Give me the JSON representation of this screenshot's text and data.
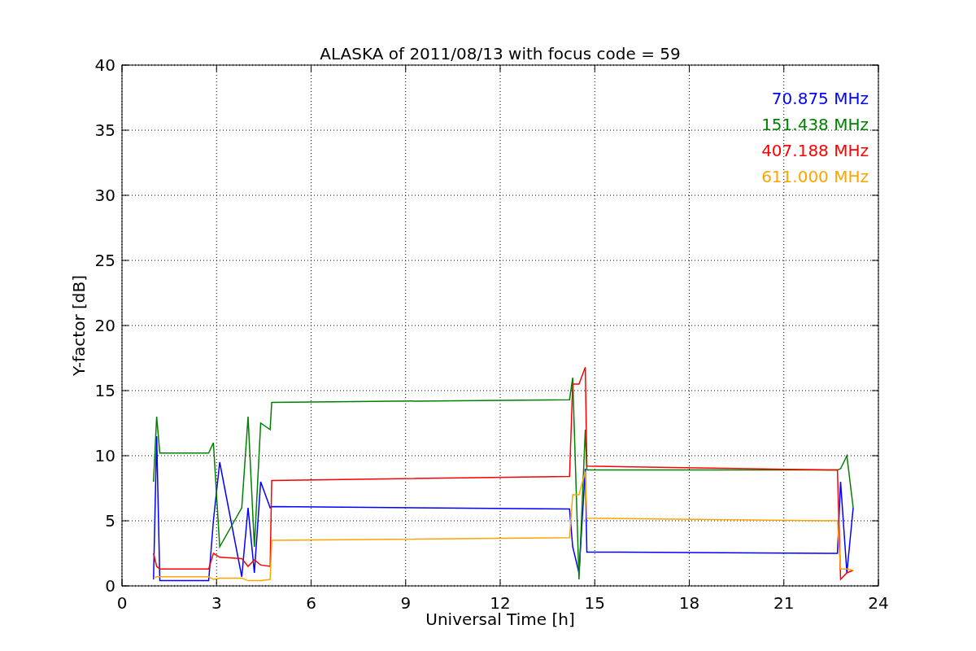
{
  "figure": {
    "chart_data": {
      "type": "line",
      "title": "ALASKA of 2011/08/13 with focus code = 59",
      "xlabel": "Universal Time [h]",
      "ylabel": "Y-factor [dB]",
      "x": [
        1.0,
        1.1,
        1.2,
        2.75,
        2.9,
        3.1,
        3.8,
        4.0,
        4.2,
        4.4,
        4.7,
        4.75,
        14.2,
        14.3,
        14.5,
        14.7,
        14.75,
        22.7,
        22.8,
        23.0,
        23.2
      ],
      "series": [
        {
          "name": "70.875 MHz",
          "color": "#0000ff",
          "values": [
            0.5,
            11.5,
            0.4,
            0.4,
            5,
            9.5,
            0.7,
            6,
            1,
            8,
            6,
            6.1,
            5.9,
            3,
            1,
            9,
            2.6,
            2.5,
            8,
            1,
            6
          ]
        },
        {
          "name": "151.438 MHz",
          "color": "#008000",
          "values": [
            8,
            13,
            10.2,
            10.2,
            11,
            3,
            6,
            13,
            3,
            12.5,
            12,
            14.1,
            14.3,
            16,
            0.5,
            12,
            8.9,
            8.9,
            9,
            10,
            6
          ]
        },
        {
          "name": "407.188 MHz",
          "color": "#ff0000",
          "values": [
            2.5,
            1.5,
            1.3,
            1.3,
            2.5,
            2.2,
            2.1,
            1.5,
            2,
            1.6,
            1.5,
            8.1,
            8.4,
            15.5,
            15.5,
            16.8,
            9.2,
            8.9,
            0.5,
            1,
            1.2
          ]
        },
        {
          "name": "611.000 MHz",
          "color": "#ffa500",
          "values": [
            0.6,
            0.7,
            0.7,
            0.7,
            0.5,
            0.6,
            0.6,
            0.4,
            0.4,
            0.4,
            0.5,
            3.5,
            3.7,
            7,
            7,
            8.8,
            5.2,
            5.0,
            1.3,
            1.3,
            1.2
          ]
        }
      ],
      "grid": true,
      "xlim": [
        0,
        24
      ],
      "ylim": [
        0,
        40
      ],
      "xticks": [
        0,
        3,
        6,
        9,
        12,
        15,
        18,
        21,
        24
      ],
      "yticks": [
        0,
        5,
        10,
        15,
        20,
        25,
        30,
        35,
        40
      ]
    }
  }
}
